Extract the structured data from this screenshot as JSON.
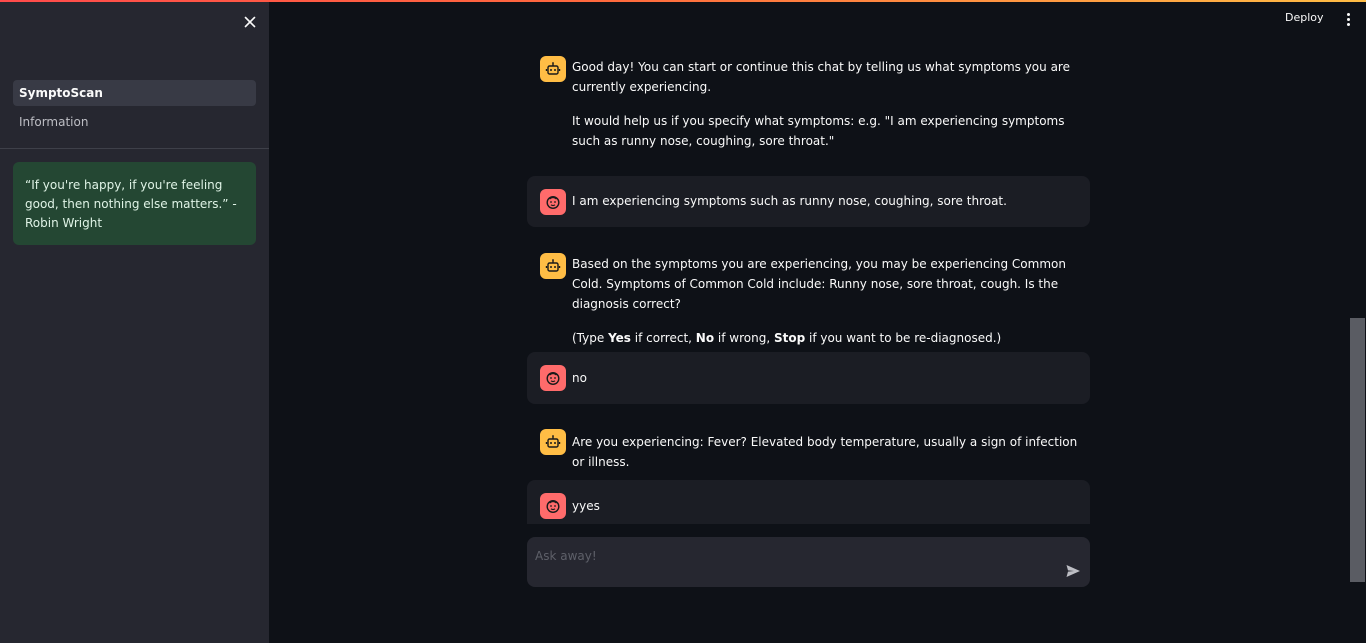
{
  "colors": {
    "accent_gradient_start": "#ff4b4b",
    "accent_gradient_end": "#ffbd45",
    "bot_avatar": "#ffbd45",
    "user_avatar": "#ff6b6b",
    "quote_bg": "#244733"
  },
  "sidebar": {
    "nav": [
      {
        "label": "SymptoScan",
        "active": true
      },
      {
        "label": "Information",
        "active": false
      }
    ],
    "quote": "“If you're happy, if you're feeling good, then nothing else matters.” - Robin Wright"
  },
  "header": {
    "deploy_label": "Deploy"
  },
  "chat": {
    "m1_p1": "Good day! You can start or continue this chat by telling us what symptoms you are currently experiencing.",
    "m1_p2": "It would help us if you specify what symptoms: e.g. \"I am experiencing symptoms such as runny nose, coughing, sore throat.\"",
    "m2": "I am experiencing symptoms such as runny nose, coughing, sore throat.",
    "m3_p1": "Based on the symptoms you are experiencing, you may be experiencing Common Cold. Symptoms of Common Cold include: Runny nose, sore throat, cough. Is the diagnosis correct?",
    "m3_p2": {
      "t1": "(Type ",
      "yes": "Yes",
      "t2": " if correct, ",
      "no": "No",
      "t3": " if wrong, ",
      "stop": "Stop",
      "t4": " if you want to be re-diagnosed.)"
    },
    "m4": "no",
    "m5": "Are you experiencing: Fever? Elevated body temperature, usually a sign of infection or illness.",
    "m6": "yyes"
  },
  "input": {
    "placeholder": "Ask away!"
  }
}
